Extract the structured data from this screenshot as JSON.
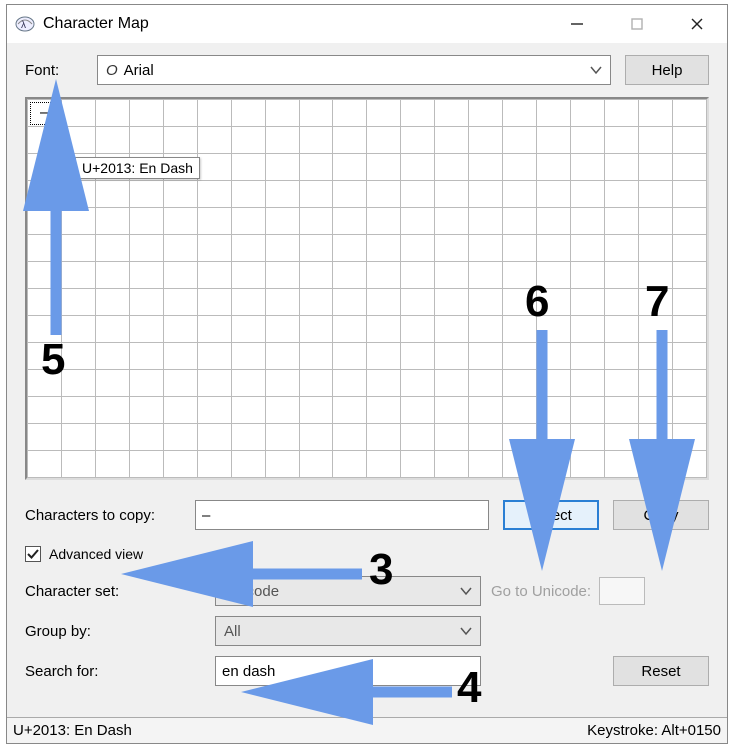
{
  "window": {
    "title": "Character Map"
  },
  "font_row": {
    "label": "Font:",
    "selected": "Arial",
    "help_button": "Help"
  },
  "grid": {
    "selected_char": "–",
    "tooltip": "U+2013: En Dash"
  },
  "copy_row": {
    "label": "Characters to copy:",
    "value": "–",
    "select_button": "Select",
    "copy_button": "Copy"
  },
  "advanced": {
    "checked": true,
    "label": "Advanced view"
  },
  "charset_row": {
    "label": "Character set:",
    "value": "Unicode",
    "goto_label": "Go to Unicode:"
  },
  "group_row": {
    "label": "Group by:",
    "value": "All"
  },
  "search_row": {
    "label": "Search for:",
    "value": "en dash",
    "reset_button": "Reset"
  },
  "statusbar": {
    "left": "U+2013: En Dash",
    "right": "Keystroke: Alt+0150"
  },
  "annotations": {
    "n3": "3",
    "n4": "4",
    "n5": "5",
    "n6": "6",
    "n7": "7"
  },
  "icons": {
    "italic_o": "O"
  }
}
